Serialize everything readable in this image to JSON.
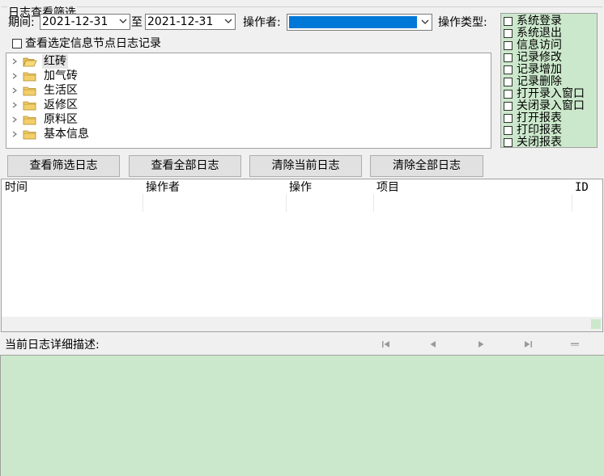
{
  "filter": {
    "group_title": "日志查看筛选",
    "period_label": "期间:",
    "date_from": "2021-12-31",
    "to_label": "至",
    "date_to": "2021-12-31",
    "operator_label": "操作者:",
    "optype_label": "操作类型:",
    "view_node_label": "查看选定信息节点日志记录"
  },
  "tree": {
    "nodes": [
      {
        "label": "红砖",
        "open": true,
        "selected": true
      },
      {
        "label": "加气砖"
      },
      {
        "label": "生活区"
      },
      {
        "label": "返修区"
      },
      {
        "label": "原料区"
      },
      {
        "label": "基本信息"
      }
    ]
  },
  "op_types": [
    "系统登录",
    "系统退出",
    "信息访问",
    "记录修改",
    "记录增加",
    "记录删除",
    "打开录入窗口",
    "关闭录入窗口",
    "打开报表",
    "打印报表",
    "关闭报表"
  ],
  "buttons": {
    "view_filtered": "查看筛选日志",
    "view_all": "查看全部日志",
    "clear_current": "清除当前日志",
    "clear_all": "清除全部日志"
  },
  "grid": {
    "columns": [
      "时间",
      "操作者",
      "操作",
      "项目",
      "ID"
    ]
  },
  "detail": {
    "label": "当前日志详细描述:"
  },
  "colors": {
    "panel_green": "#cce8cc",
    "selection_blue": "#0078d7"
  }
}
